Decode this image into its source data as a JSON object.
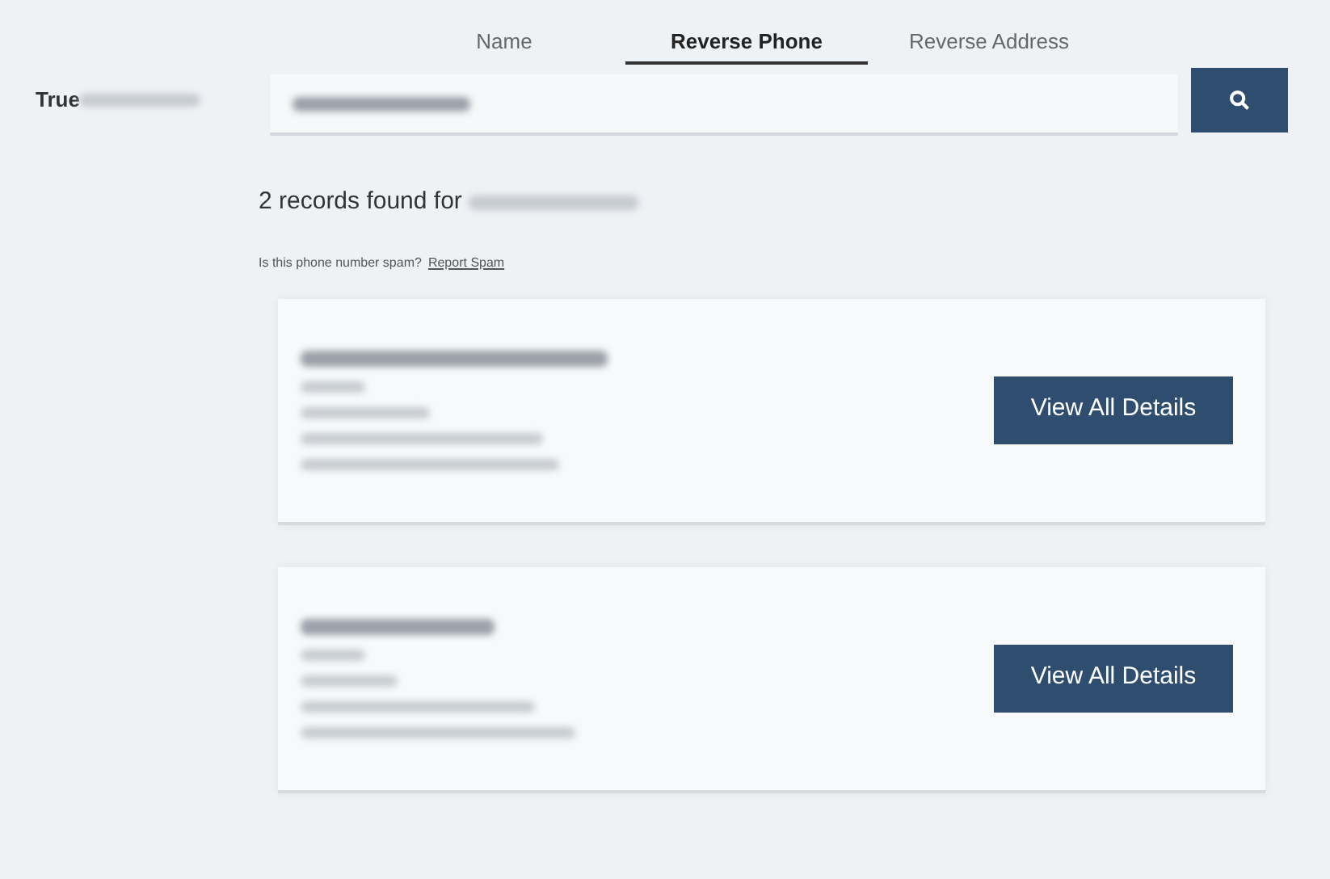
{
  "logo": {
    "text": "True"
  },
  "tabs": [
    {
      "label": "Name",
      "selected": false
    },
    {
      "label": "Reverse Phone",
      "selected": true
    },
    {
      "label": "Reverse Address",
      "selected": false
    }
  ],
  "results": {
    "heading": "2 records found for",
    "spam_question": "Is this phone number spam?",
    "spam_link": "Report Spam"
  },
  "records": [
    {
      "button": "View All Details"
    },
    {
      "button": "View All Details"
    }
  ]
}
